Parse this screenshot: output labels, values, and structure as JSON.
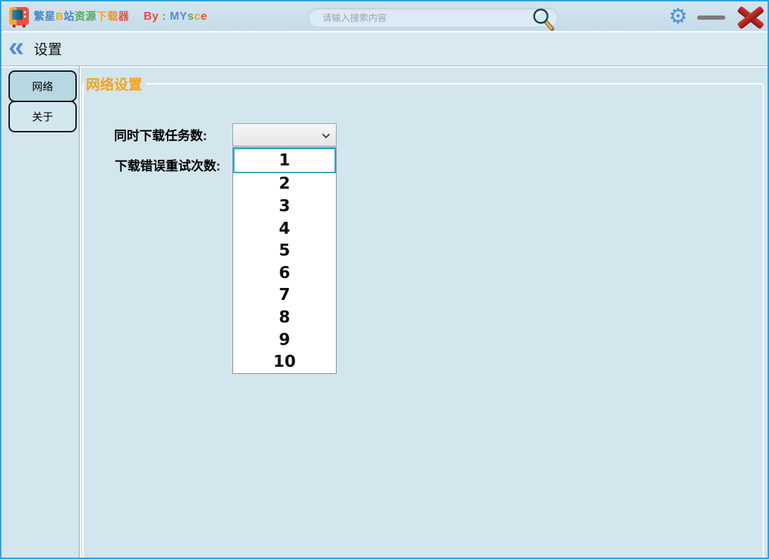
{
  "colors": {
    "window_border": "#2f9fe0",
    "topbar_bg": "#cde1eb",
    "content_bg": "#d3e5ed",
    "accent_orange": "#f2a51c",
    "sidebar_active_bg": "#b7d8e2",
    "sidebar_inactive_bg": "#d2e7ee",
    "gear_blue": "#4792dd",
    "close_red": "#b12824",
    "minimize_gray": "#7b7b7b",
    "back_chevron_blue": "#5b8bd4",
    "dropdown_highlight_border": "#3f9fc4"
  },
  "topbar": {
    "app_icon": "tv-icon",
    "title": "繁星B站资源下载器",
    "title_chars": [
      {
        "ch": "繁",
        "style": "color:#4a86c7"
      },
      {
        "ch": "星",
        "style": "color:#4a86c7"
      },
      {
        "ch": "B",
        "style": "color:#f0a42a"
      },
      {
        "ch": "站",
        "style": "color:#4a86c7"
      },
      {
        "ch": "资",
        "style": "color:#57a85c"
      },
      {
        "ch": "源",
        "style": "color:#57a85c"
      },
      {
        "ch": "下",
        "style": "color:#f0a43c"
      },
      {
        "ch": "载",
        "style": "color:#e8943c"
      },
      {
        "ch": "器",
        "style": "color:#e0564a"
      }
    ],
    "byline": "By : MYsce",
    "byline_parts": [
      {
        "t": "By",
        "style": "color:#e04b45"
      },
      {
        "t": " : ",
        "style": "color:#57a85c"
      },
      {
        "t": "MY",
        "style": "color:#4a8fd3"
      },
      {
        "t": "s",
        "style": "color:#57a85c"
      },
      {
        "t": "c",
        "style": "color:#f0a42a"
      },
      {
        "t": "e",
        "style": "color:#e04b45"
      }
    ],
    "search": {
      "placeholder": "请输入搜索内容",
      "icon": "search-magnifier-icon"
    },
    "window_controls": {
      "settings_icon": "gear-icon",
      "settings_glyph": "⚙",
      "minimize_icon": "minimize-icon",
      "close_icon": "close-icon"
    }
  },
  "navbar": {
    "back_glyph": "«",
    "title": "设置"
  },
  "sidebar": {
    "items": [
      {
        "label": "网络",
        "active": true
      },
      {
        "label": "关于",
        "active": false
      }
    ]
  },
  "main": {
    "group_title": "网络设置",
    "fields": [
      {
        "label": "同时下载任务数:"
      },
      {
        "label": "下载错误重试次数:"
      }
    ],
    "combobox": {
      "value": "",
      "state": "open"
    },
    "dropdown": {
      "options": [
        "1",
        "2",
        "3",
        "4",
        "5",
        "6",
        "7",
        "8",
        "9",
        "10"
      ],
      "highlighted": "1"
    }
  }
}
